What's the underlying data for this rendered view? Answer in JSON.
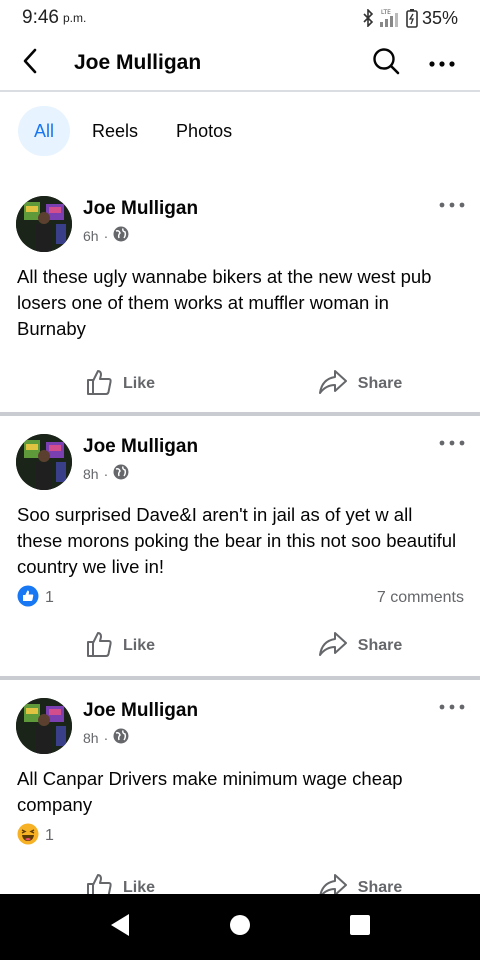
{
  "status_bar": {
    "time": "9:46",
    "ampm": "p.m.",
    "network": "LTE",
    "battery": "35%"
  },
  "app_bar": {
    "title": "Joe Mulligan",
    "icons": [
      "back-arrow-icon",
      "search-icon",
      "more-dots-icon"
    ]
  },
  "tabs": [
    {
      "label": "All",
      "active": true
    },
    {
      "label": "Reels",
      "active": false
    },
    {
      "label": "Photos",
      "active": false
    }
  ],
  "posts": [
    {
      "author": "Joe Mulligan",
      "time": "6h",
      "privacy": "globe-icon",
      "text": "All these ugly wannabe bikers at the new west pub losers one of them works at muffler woman in Burnaby",
      "reactions": null,
      "comments": null
    },
    {
      "author": "Joe Mulligan",
      "time": "8h",
      "privacy": "globe-icon",
      "text": "Soo surprised Dave&I aren't in jail as of yet w all these morons poking the bear in this not soo beautiful country we live in!",
      "reactions": {
        "icon": "like-reaction-icon",
        "count": "1"
      },
      "comments": "7 comments"
    },
    {
      "author": "Joe Mulligan",
      "time": "8h",
      "privacy": "globe-icon",
      "text": "All Canpar Drivers make minimum wage cheap company",
      "reactions": {
        "icon": "haha-reaction-icon",
        "count": "1"
      },
      "comments": null
    }
  ],
  "actions": {
    "like_label": "Like",
    "share_label": "Share"
  },
  "colors": {
    "accent": "#1877f2",
    "tab_active_bg": "#e7f3ff",
    "secondary_text": "#65676b",
    "divider": "#c9ccd1"
  }
}
